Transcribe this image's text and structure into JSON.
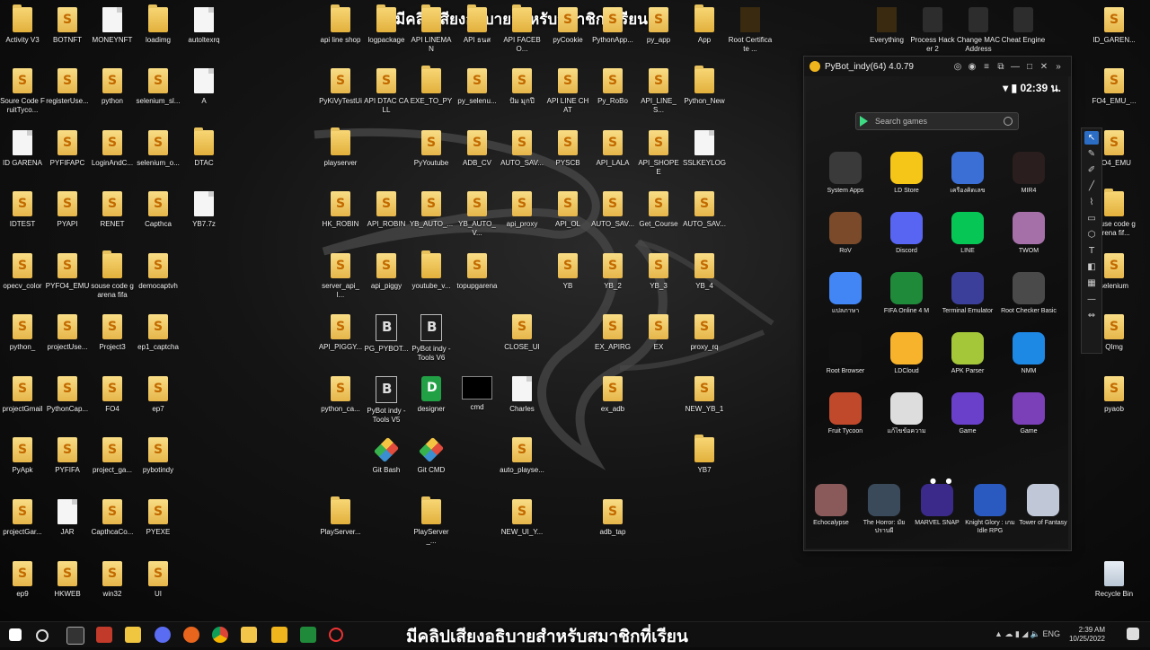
{
  "overlay": {
    "caption": "มีคลิปเสียงอธิบายสำหรับสมาชิกที่เรียน"
  },
  "desktop": {
    "icons": [
      {
        "label": "Activity V3",
        "type": "folder"
      },
      {
        "label": "BOTNFT",
        "type": "py"
      },
      {
        "label": "MONEYNFT",
        "type": "doc"
      },
      {
        "label": "loadimg",
        "type": "folder"
      },
      {
        "label": "autoltexrq",
        "type": "doc"
      },
      {
        "label": "Soure Code FruitTyco...",
        "type": "py"
      },
      {
        "label": "registerUse...",
        "type": "py"
      },
      {
        "label": "python",
        "type": "py"
      },
      {
        "label": "selenium_sl...",
        "type": "py"
      },
      {
        "label": "A",
        "type": "doc"
      },
      {
        "label": "ID GARENA",
        "type": "doc"
      },
      {
        "label": "PYFIFAPC",
        "type": "py"
      },
      {
        "label": "LoginAndC...",
        "type": "py"
      },
      {
        "label": "selenium_o...",
        "type": "py"
      },
      {
        "label": "DTAC",
        "type": "folder"
      },
      {
        "label": "IDTEST",
        "type": "py"
      },
      {
        "label": "PYAPI",
        "type": "py"
      },
      {
        "label": "RENET",
        "type": "py"
      },
      {
        "label": "Capthca",
        "type": "py"
      },
      {
        "label": "YB7.7z",
        "type": "doc"
      },
      {
        "label": "opecv_color",
        "type": "py"
      },
      {
        "label": "PYFO4_EMU",
        "type": "py"
      },
      {
        "label": "souse code garena fifa",
        "type": "folder"
      },
      {
        "label": "democaptvh",
        "type": "py"
      },
      {
        "label": "python_",
        "type": "py"
      },
      {
        "label": "projectUse...",
        "type": "py"
      },
      {
        "label": "Project3",
        "type": "py"
      },
      {
        "label": "ep1_captcha",
        "type": "py"
      },
      {
        "label": "projectGmail",
        "type": "py"
      },
      {
        "label": "PythonCap...",
        "type": "py"
      },
      {
        "label": "FO4",
        "type": "py"
      },
      {
        "label": "ep7",
        "type": "py"
      },
      {
        "label": "PyApk",
        "type": "py"
      },
      {
        "label": "PYFIFA",
        "type": "py"
      },
      {
        "label": "project_ga...",
        "type": "py"
      },
      {
        "label": "pybotindy",
        "type": "py"
      },
      {
        "label": "projectGar...",
        "type": "py"
      },
      {
        "label": "JAR",
        "type": "doc"
      },
      {
        "label": "CapthcaCo...",
        "type": "py"
      },
      {
        "label": "PYEXE",
        "type": "py"
      },
      {
        "label": "ep9",
        "type": "py"
      },
      {
        "label": "HKWEB",
        "type": "py"
      },
      {
        "label": "win32",
        "type": "py"
      },
      {
        "label": "UI",
        "type": "py"
      },
      {
        "label": "api line shop",
        "type": "folder"
      },
      {
        "label": "logpackage",
        "type": "folder"
      },
      {
        "label": "API LINEMAN",
        "type": "folder"
      },
      {
        "label": "API ธนส",
        "type": "folder"
      },
      {
        "label": "API FACEBO...",
        "type": "folder"
      },
      {
        "label": "pyCookie",
        "type": "py"
      },
      {
        "label": "PythonApp...",
        "type": "py"
      },
      {
        "label": "py_app",
        "type": "py"
      },
      {
        "label": "App",
        "type": "folder"
      },
      {
        "label": "Root Certificate ...",
        "type": "orange"
      },
      {
        "label": "PyKiVyTestUi",
        "type": "py"
      },
      {
        "label": "API DTAC CALL",
        "type": "py"
      },
      {
        "label": "EXE_TO_PY",
        "type": "folder"
      },
      {
        "label": "py_selenu...",
        "type": "py"
      },
      {
        "label": "ปั้ม มุกปี",
        "type": "py"
      },
      {
        "label": "API LINE CHAT",
        "type": "py"
      },
      {
        "label": "Py_RoBo",
        "type": "py"
      },
      {
        "label": "API_LINE_S...",
        "type": "py"
      },
      {
        "label": "Python_New",
        "type": "folder"
      },
      {
        "label": "playserver",
        "type": "folder"
      },
      {
        "label": "PyYoutube",
        "type": "py"
      },
      {
        "label": "ADB_CV",
        "type": "py"
      },
      {
        "label": "AUTO_SAV...",
        "type": "py"
      },
      {
        "label": "PYSCB",
        "type": "py"
      },
      {
        "label": "API_LALA",
        "type": "py"
      },
      {
        "label": "API_SHOPEE",
        "type": "py"
      },
      {
        "label": "SSLKEYLOG",
        "type": "doc"
      },
      {
        "label": "HK_ROBIN",
        "type": "py"
      },
      {
        "label": "API_ROBIN",
        "type": "py"
      },
      {
        "label": "YB_AUTO_...",
        "type": "py"
      },
      {
        "label": "YB_AUTO_V...",
        "type": "py"
      },
      {
        "label": "api_proxy",
        "type": "py"
      },
      {
        "label": "API_OL",
        "type": "py"
      },
      {
        "label": "AUTO_SAV...",
        "type": "py"
      },
      {
        "label": "Get_Course",
        "type": "py"
      },
      {
        "label": "AUTO_SAV...",
        "type": "py"
      },
      {
        "label": "server_api_l...",
        "type": "py"
      },
      {
        "label": "api_piggy",
        "type": "py"
      },
      {
        "label": "youtube_v...",
        "type": "folder"
      },
      {
        "label": "topupgarena",
        "type": "py"
      },
      {
        "label": "YB",
        "type": "py"
      },
      {
        "label": "YB_2",
        "type": "py"
      },
      {
        "label": "YB_3",
        "type": "py"
      },
      {
        "label": "YB_4",
        "type": "py"
      },
      {
        "label": "API_PIGGY...",
        "type": "py"
      },
      {
        "label": "PG_PYBOT...",
        "type": "bookapp"
      },
      {
        "label": "PyBot indy - Tools V6",
        "type": "bookapp"
      },
      {
        "label": "CLOSE_UI",
        "type": "py"
      },
      {
        "label": "EX_APIRG",
        "type": "py"
      },
      {
        "label": "EX",
        "type": "py"
      },
      {
        "label": "proxy_rq",
        "type": "py"
      },
      {
        "label": "python_ca...",
        "type": "py"
      },
      {
        "label": "PyBot indy - Tools V5",
        "type": "bookapp"
      },
      {
        "label": "designer",
        "type": "greenapp"
      },
      {
        "label": "cmd",
        "type": "blackapp"
      },
      {
        "label": "Charles",
        "type": "doc"
      },
      {
        "label": "ex_adb",
        "type": "py"
      },
      {
        "label": "NEW_YB_1",
        "type": "py"
      },
      {
        "label": "Git Bash",
        "type": "gitapp"
      },
      {
        "label": "Git CMD",
        "type": "gitapp"
      },
      {
        "label": "auto_playse...",
        "type": "py"
      },
      {
        "label": "YB7",
        "type": "folder"
      },
      {
        "label": "PlayServer...",
        "type": "folder"
      },
      {
        "label": "PlayServer_...",
        "type": "folder"
      },
      {
        "label": "NEW_UI_Y...",
        "type": "py"
      },
      {
        "label": "adb_tap",
        "type": "py"
      },
      {
        "label": "Everything",
        "type": "orange"
      },
      {
        "label": "Process Hacker 2",
        "type": "app"
      },
      {
        "label": "Change MAC Address",
        "type": "app"
      },
      {
        "label": "Cheat Engine",
        "type": "app"
      },
      {
        "label": "ID_GAREN...",
        "type": "py"
      },
      {
        "label": "FO4_EMU_...",
        "type": "py"
      },
      {
        "label": "FO4_EMU",
        "type": "py"
      },
      {
        "label": "souse code garena fif...",
        "type": "folder"
      },
      {
        "label": "selenium",
        "type": "py"
      },
      {
        "label": "QImg",
        "type": "py"
      },
      {
        "label": "pyaob",
        "type": "py"
      },
      {
        "label": "Recycle Bin",
        "type": "recycle"
      }
    ]
  },
  "emulator": {
    "title": "PyBot_indy(64) 4.0.79",
    "time": "02:39 น.",
    "search_placeholder": "Search games",
    "apps": [
      {
        "label": "System Apps",
        "color": "#3a3a3a"
      },
      {
        "label": "LD Store",
        "color": "#f5c518"
      },
      {
        "label": "เครื่องคิดเลข",
        "color": "#3b6fd6"
      },
      {
        "label": "MIR4",
        "color": "#2a1e1e"
      },
      {
        "label": "RoV",
        "color": "#7a4a2a"
      },
      {
        "label": "Discord",
        "color": "#5865f2"
      },
      {
        "label": "LINE",
        "color": "#06c755"
      },
      {
        "label": "TWOM",
        "color": "#a56fa8"
      },
      {
        "label": "แปลภาษา",
        "color": "#4285f4"
      },
      {
        "label": "FIFA Online 4 M",
        "color": "#1e8a3a"
      },
      {
        "label": "Terminal Emulator",
        "color": "#3c3f9a"
      },
      {
        "label": "Root Checker Basic",
        "color": "#4a4a4a"
      },
      {
        "label": "Root Browser",
        "color": "#111111"
      },
      {
        "label": "LDCloud",
        "color": "#f7b32b"
      },
      {
        "label": "APK Parser",
        "color": "#a4c639"
      },
      {
        "label": "NMM",
        "color": "#1e88e5"
      },
      {
        "label": "Fruit Tycoon",
        "color": "#c0492b"
      },
      {
        "label": "แก้ไขข้อความ",
        "color": "#dddddd"
      },
      {
        "label": "Game",
        "color": "#6a3fc9"
      },
      {
        "label": "Game",
        "color": "#7b3fb8"
      }
    ],
    "dock": [
      {
        "label": "Echocalypse",
        "color": "#8a5a5a"
      },
      {
        "label": "The Horror: มัย ปราบผี",
        "color": "#3a4a5a"
      },
      {
        "label": "MARVEL SNAP",
        "color": "#3b2a8a"
      },
      {
        "label": "Knight Glory : เกม Idle RPG",
        "color": "#2a5ac0"
      },
      {
        "label": "Tower of Fantasy",
        "color": "#c0c8d8"
      }
    ]
  },
  "taskbar": {
    "lang": "ENG",
    "time": "2:39 AM",
    "date": "10/25/2022"
  }
}
